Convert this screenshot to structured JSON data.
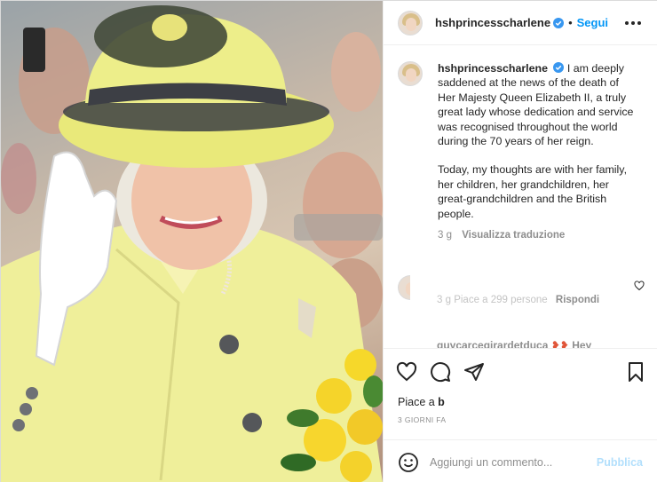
{
  "post": {
    "username": "hshprincesscharlene",
    "separator": "•",
    "follow_label": "Segui",
    "caption": {
      "username": "hshprincesscharlene",
      "paragraph1": "I am deeply saddened at the news of the death of Her Majesty Queen Elizabeth II, a truly great lady whose dedication and service was recognised throughout the world during the 70 years of her reign.",
      "paragraph2": "Today, my thoughts are with her family, her children, her grandchildren, her great-grandchildren and the British people.",
      "age": "3 g",
      "translate_label": "Visualizza traduzione"
    },
    "comment2": {
      "age": "3 g",
      "likes_text": "Piace a 299 persone",
      "reply_label": "Rispondi"
    },
    "comment3": {
      "username": "guycarcegirardetduca",
      "partial_text": "Hey"
    },
    "likes_prefix": "Piace a ",
    "likes_user": "b",
    "date": "3 GIORNI FA",
    "add_comment_placeholder": "Aggiungi un commento...",
    "publish_label": "Pubblica"
  },
  "icons": {
    "verified": "verified-badge-icon",
    "more": "more-options-icon",
    "like": "heart-icon",
    "comment": "comment-bubble-icon",
    "share": "paper-plane-icon",
    "save": "bookmark-icon",
    "emoji": "emoji-smiley-icon"
  },
  "colors": {
    "accent": "#0095f6",
    "verified": "#3897f0",
    "publish_disabled": "#b2dffc",
    "text": "#262626",
    "muted": "#8e8e8e",
    "coat_yellow": "#efef9a"
  }
}
